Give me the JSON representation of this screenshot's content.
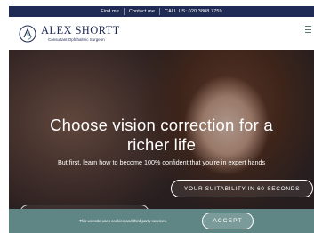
{
  "topbar": {
    "links": [
      "Find me",
      "Contact me",
      "CALL US: 020 3808 7759"
    ]
  },
  "header": {
    "logo_name": "ALEX SHORTT",
    "logo_sub": "Consultant Ophthalmic Surgeon",
    "menu_icon": "hamburger-menu-icon"
  },
  "hero": {
    "title": "Choose vision correction for a richer life",
    "subtitle": "But first, learn how to become 100% confident that you're in expert hands",
    "cta_label": "YOUR SUITABILITY IN 60-SECONDS"
  },
  "cookie": {
    "text": "This website uses cookies and third party services.",
    "accept_label": "ACCEPT"
  },
  "colors": {
    "navy": "#1f2a55",
    "teal": "#5f8684",
    "white": "#ffffff"
  }
}
